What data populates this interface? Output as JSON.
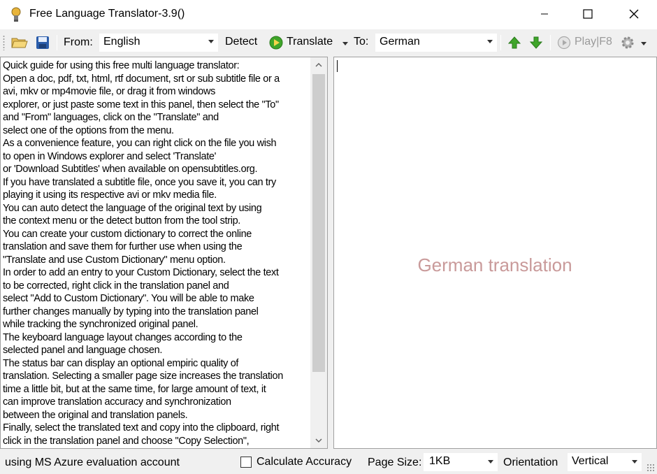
{
  "window": {
    "title": "Free Language Translator-3.9()",
    "app_icon": "bulb-icon"
  },
  "toolbar": {
    "from_label": "From:",
    "from_language": "English",
    "detect_label": "Detect",
    "translate_label": "Translate",
    "to_label": "To:",
    "to_language": "German",
    "play_label": "Play|F8",
    "icons": [
      "open-folder-icon",
      "save-icon",
      "translate-icon",
      "arrow-up-icon",
      "arrow-down-icon",
      "play-icon",
      "gear-icon"
    ]
  },
  "source_panel": {
    "lines": [
      "Quick guide for using this free multi language translator:",
      "Open a doc, pdf, txt, html, rtf document, srt or sub subtitle file or a",
      "avi, mkv or mp4movie file, or drag it from windows",
      "explorer, or just paste some text in this panel, then select the \"To\"",
      "and \"From\" languages, click on the \"Translate\" and",
      "select one of the options from the menu.",
      "As a convenience feature, you can right click on the file you wish",
      "to open in Windows explorer and select 'Translate'",
      "or 'Download Subtitles' when available on opensubtitles.org.",
      "If you have translated a subtitle file, once you save it, you can try",
      "playing it using its respective avi or mkv media file.",
      "You can auto detect the language of the original text by using",
      "the context menu or the detect button from the tool strip.",
      "You can create your custom dictionary to correct the online",
      "translation and save them for further use when using the",
      "\"Translate and use Custom Dictionary\" menu option.",
      "In order to add an entry to your Custom Dictionary, select the text",
      "to be corrected, right click in the translation panel and",
      "select \"Add to Custom Dictionary\". You will be able to make",
      "further changes manually by typing into the translation panel",
      "while tracking the synchronized original panel.",
      "The keyboard language layout changes according to the",
      "selected panel and language chosen.",
      "The status bar can display an optional empiric quality of",
      "translation. Selecting a smaller page size increases the translation",
      "time a little bit, but at the same time, for large amount of text, it",
      "can improve translation accuracy and synchronization",
      "between the original and translation panels.",
      "Finally, select the translated text and copy into the clipboard, right",
      "click in the translation panel and choose \"Copy Selection\","
    ]
  },
  "target_panel": {
    "watermark": "German translation"
  },
  "statusbar": {
    "account_text": "using MS Azure evaluation account",
    "calc_accuracy_label": "Calculate Accuracy",
    "calc_accuracy_checked": false,
    "page_size_label": "Page Size:",
    "page_size_value": "1KB",
    "orientation_label": "Orientation",
    "orientation_value": "Vertical"
  },
  "colors": {
    "watermark": "#c99a9a",
    "arrow_green": "#3fa52a",
    "save_blue": "#2a5caa"
  }
}
